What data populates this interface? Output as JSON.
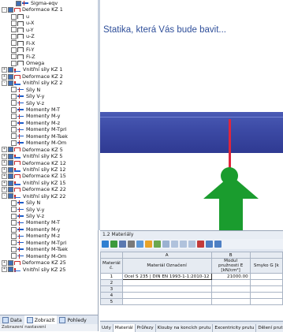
{
  "tree": [
    {
      "indent": 3,
      "toggle": "",
      "check": true,
      "icon": "result-icon",
      "label": "Sigma-eqv"
    },
    {
      "indent": 0,
      "toggle": "-",
      "check": true,
      "icon": "load-case-icon",
      "label": "Deformace KZ 1"
    },
    {
      "indent": 2,
      "toggle": "",
      "check": false,
      "icon": "deformation-icon",
      "label": "u"
    },
    {
      "indent": 2,
      "toggle": "",
      "check": false,
      "icon": "deformation-icon",
      "label": "u-X"
    },
    {
      "indent": 2,
      "toggle": "",
      "check": false,
      "icon": "deformation-icon",
      "label": "u-Y"
    },
    {
      "indent": 2,
      "toggle": "",
      "check": false,
      "icon": "deformation-icon",
      "label": "u-Z"
    },
    {
      "indent": 2,
      "toggle": "",
      "check": false,
      "icon": "deformation-icon",
      "label": "Fi-X"
    },
    {
      "indent": 2,
      "toggle": "",
      "check": false,
      "icon": "deformation-icon",
      "label": "Fi-Y"
    },
    {
      "indent": 2,
      "toggle": "",
      "check": false,
      "icon": "deformation-icon",
      "label": "Fi-Z"
    },
    {
      "indent": 2,
      "toggle": "",
      "check": false,
      "icon": "deformation-icon",
      "label": "Omega"
    },
    {
      "indent": 0,
      "toggle": "+",
      "check": true,
      "icon": "internal-forces-icon",
      "label": "Vnitřní síly KZ 1"
    },
    {
      "indent": 0,
      "toggle": "+",
      "check": true,
      "icon": "load-case-icon",
      "label": "Deformace KZ 2"
    },
    {
      "indent": 0,
      "toggle": "-",
      "check": true,
      "icon": "internal-forces-icon",
      "label": "Vnitřní síly KZ 2"
    },
    {
      "indent": 2,
      "toggle": "",
      "check": false,
      "icon": "result-icon",
      "label": "Síly N"
    },
    {
      "indent": 2,
      "toggle": "",
      "check": false,
      "icon": "result-icon",
      "label": "Síly V-y"
    },
    {
      "indent": 2,
      "toggle": "",
      "check": false,
      "icon": "result-icon",
      "label": "Síly V-z"
    },
    {
      "indent": 2,
      "toggle": "",
      "check": false,
      "icon": "result-icon",
      "label": "Momenty M-T"
    },
    {
      "indent": 2,
      "toggle": "",
      "check": false,
      "icon": "result-icon",
      "label": "Momenty M-y"
    },
    {
      "indent": 2,
      "toggle": "",
      "check": false,
      "icon": "result-icon",
      "label": "Momenty M-z"
    },
    {
      "indent": 2,
      "toggle": "",
      "check": false,
      "icon": "result-icon",
      "label": "Momenty M-Tpri"
    },
    {
      "indent": 2,
      "toggle": "",
      "check": false,
      "icon": "result-icon",
      "label": "Momenty M-Tsek"
    },
    {
      "indent": 2,
      "toggle": "",
      "check": false,
      "icon": "result-icon",
      "label": "Momenty M-Om"
    },
    {
      "indent": 0,
      "toggle": "+",
      "check": true,
      "icon": "load-case-icon",
      "label": "Deformace KZ 5"
    },
    {
      "indent": 0,
      "toggle": "+",
      "check": true,
      "icon": "internal-forces-icon",
      "label": "Vnitřní síly KZ 5"
    },
    {
      "indent": 0,
      "toggle": "+",
      "check": true,
      "icon": "load-case-icon",
      "label": "Deformace KZ 12"
    },
    {
      "indent": 0,
      "toggle": "+",
      "check": true,
      "icon": "internal-forces-icon",
      "label": "Vnitřní síly KZ 12"
    },
    {
      "indent": 0,
      "toggle": "+",
      "check": true,
      "icon": "load-case-icon",
      "label": "Deformace KZ 15"
    },
    {
      "indent": 0,
      "toggle": "+",
      "check": true,
      "icon": "internal-forces-icon",
      "label": "Vnitřní síly KZ 15"
    },
    {
      "indent": 0,
      "toggle": "+",
      "check": true,
      "icon": "load-case-icon",
      "label": "Deformace KZ 22"
    },
    {
      "indent": 0,
      "toggle": "-",
      "check": true,
      "icon": "internal-forces-icon",
      "label": "Vnitřní síly KZ 22"
    },
    {
      "indent": 2,
      "toggle": "",
      "check": false,
      "icon": "result-icon",
      "label": "Síly N"
    },
    {
      "indent": 2,
      "toggle": "",
      "check": false,
      "icon": "result-icon",
      "label": "Síly V-y"
    },
    {
      "indent": 2,
      "toggle": "",
      "check": false,
      "icon": "result-icon",
      "label": "Síly V-z"
    },
    {
      "indent": 2,
      "toggle": "",
      "check": false,
      "icon": "result-icon",
      "label": "Momenty M-T"
    },
    {
      "indent": 2,
      "toggle": "",
      "check": false,
      "icon": "result-icon",
      "label": "Momenty M-y"
    },
    {
      "indent": 2,
      "toggle": "",
      "check": false,
      "icon": "result-icon",
      "label": "Momenty M-z"
    },
    {
      "indent": 2,
      "toggle": "",
      "check": false,
      "icon": "result-icon",
      "label": "Momenty M-Tpri"
    },
    {
      "indent": 2,
      "toggle": "",
      "check": false,
      "icon": "result-icon",
      "label": "Momenty M-Tsek"
    },
    {
      "indent": 2,
      "toggle": "",
      "check": false,
      "icon": "result-icon",
      "label": "Momenty M-Om"
    },
    {
      "indent": 0,
      "toggle": "+",
      "check": true,
      "icon": "load-case-icon",
      "label": "Deformace KZ 25"
    },
    {
      "indent": 0,
      "toggle": "+",
      "check": true,
      "icon": "internal-forces-icon",
      "label": "Vnitřní síly KZ 25"
    }
  ],
  "nav_tabs": [
    {
      "label": "Data",
      "icon": "data-icon",
      "active": false
    },
    {
      "label": "Zobrazit",
      "icon": "display-icon",
      "active": true
    },
    {
      "label": "Pohledy",
      "icon": "views-icon",
      "active": false
    }
  ],
  "nav_footer": "Zobrazení nastavení",
  "graphics": {
    "tagline": "Statika, která Vás bude bavit...",
    "colors": {
      "beam": "#3d4ba6",
      "member": "#e0263c",
      "support": "#1a9c2e",
      "tagline": "#2f4f9a"
    }
  },
  "panel": {
    "title": "1.2 Materiály",
    "columns": {
      "group_row": [
        "",
        "A",
        "B",
        ""
      ],
      "labels": [
        "Materiál č.",
        "Materiál Označení",
        "Modul pružnosti E [kN/cm²]",
        "Smyko G [k"
      ]
    },
    "rows": [
      {
        "num": "1",
        "name": "Ocel S 235 | DIN EN 1993-1-1:2010-12",
        "e": "21000.00",
        "g": ""
      },
      {
        "num": "2",
        "name": "",
        "e": "",
        "g": ""
      },
      {
        "num": "3",
        "name": "",
        "e": "",
        "g": ""
      },
      {
        "num": "4",
        "name": "",
        "e": "",
        "g": ""
      },
      {
        "num": "5",
        "name": "",
        "e": "",
        "g": ""
      }
    ],
    "tabs": [
      {
        "label": "Uzly",
        "active": false
      },
      {
        "label": "Materiál",
        "active": true
      },
      {
        "label": "Průřezy",
        "active": false
      },
      {
        "label": "Klouby na koncích prutu",
        "active": false
      },
      {
        "label": "Excentricity prutu",
        "active": false
      },
      {
        "label": "Dělení prutu",
        "active": false
      }
    ]
  }
}
